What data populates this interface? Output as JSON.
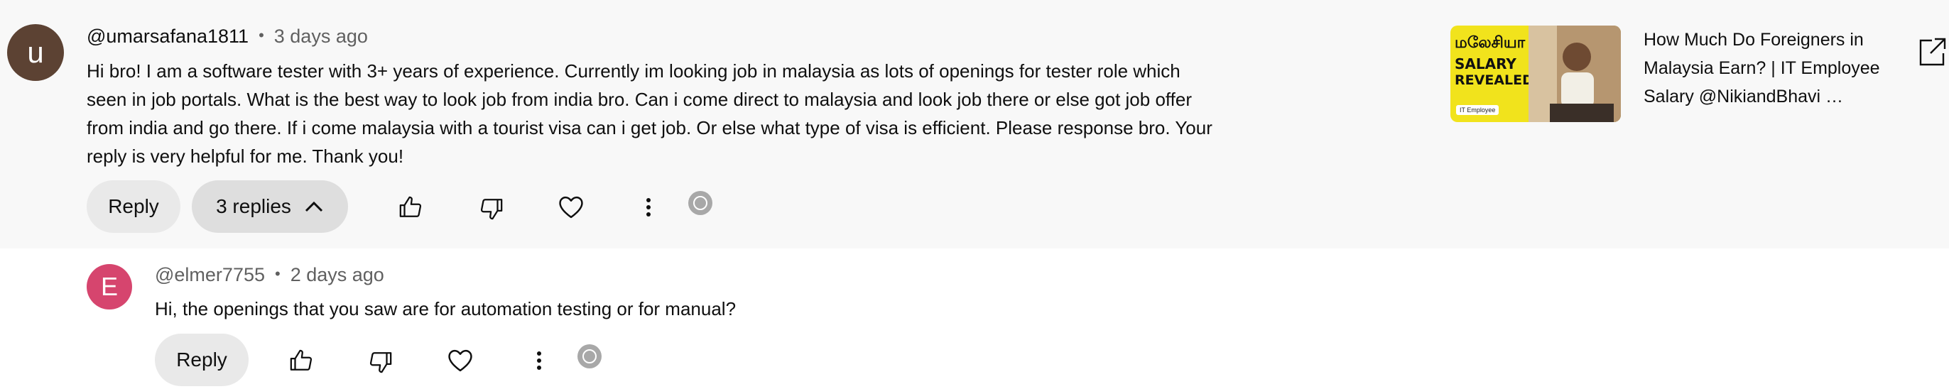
{
  "comment": {
    "avatar_letter": "u",
    "handle": "@umarsafana1811",
    "separator": "•",
    "time": "3 days ago",
    "text_lines": [
      "Hi bro! I am a software tester with 3+ years of experience. Currently im looking job in malaysia as lots of openings for tester role which",
      "seen in job portals. What is the best way to look job from india bro. Can i come direct to malaysia and look job there or else got job offer",
      "from india and go there. If i come malaysia with a tourist visa can i get job. Or else what type of visa is efficient. Please response bro. Your",
      "reply is very helpful for me. Thank you!"
    ],
    "reply_label": "Reply",
    "replies_label": "3 replies"
  },
  "video": {
    "thumb_line1": "மலேசியா",
    "thumb_line2": "SALARY",
    "thumb_line3": "REVEALED!",
    "thumb_badge": "IT Employee",
    "title_lines": [
      "How Much Do Foreigners in",
      "Malaysia Earn? | IT Employee",
      "Salary @NikiandBhavi …"
    ]
  },
  "reply": {
    "avatar_letter": "E",
    "handle": "@elmer7755",
    "separator": "•",
    "time": "2 days ago",
    "text": "Hi, the openings that you saw are for automation testing or for manual?",
    "reply_label": "Reply"
  },
  "icons": {
    "like": "thumbs-up-icon",
    "dislike": "thumbs-down-icon",
    "heart": "heart-icon",
    "more": "more-vert-icon",
    "badge": "iq-badge-icon",
    "open": "open-external-icon",
    "chevron": "chevron-up-icon"
  },
  "colors": {
    "avatar1": "#5c4233",
    "avatar2": "#d6456e",
    "thumb_bg": "#f1e31c"
  }
}
